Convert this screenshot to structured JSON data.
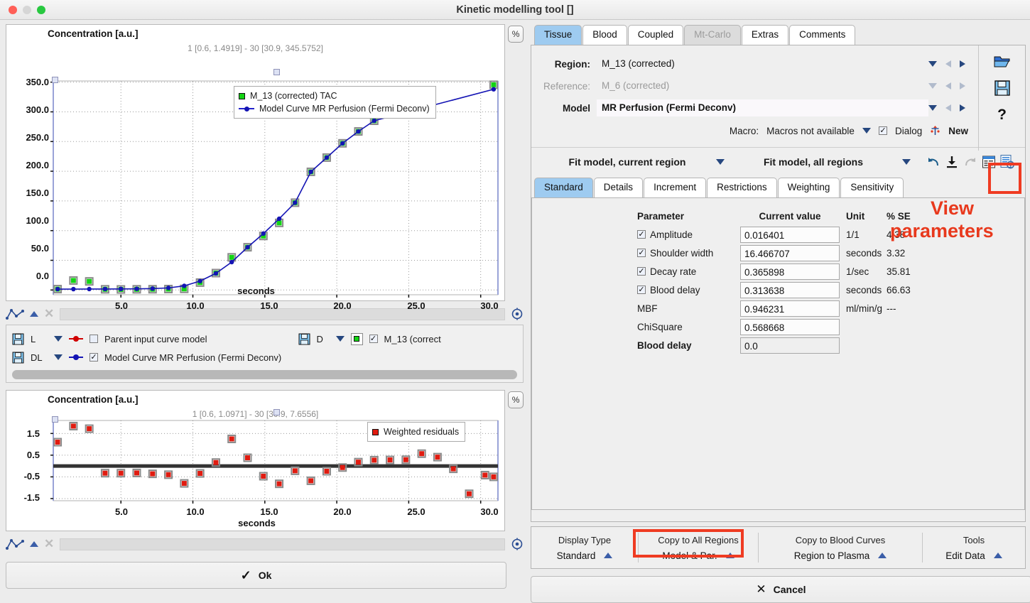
{
  "window": {
    "title": "Kinetic modelling tool []"
  },
  "charts": {
    "main": {
      "title": "Concentration [a.u.]",
      "range_label": "1 [0.6, 1.4919] - 30 [30.9, 345.5752]",
      "xlabel": "seconds",
      "pct_button": "%",
      "legend": [
        {
          "label": "M_13 (corrected) TAC",
          "marker": "square-green"
        },
        {
          "label": "Model Curve MR Perfusion (Fermi Deconv)",
          "marker": "line-blue-dot"
        }
      ]
    },
    "residuals": {
      "title": "Concentration [a.u.]",
      "range_label": "1 [0.6, 1.0971] - 30 [30.9, 7.6556]",
      "xlabel": "seconds",
      "pct_button": "%",
      "legend": [
        {
          "label": "Weighted residuals",
          "marker": "square-red"
        }
      ]
    }
  },
  "chart_data": [
    {
      "type": "scatter",
      "name": "main-tac-plot",
      "title": "Concentration [a.u.]",
      "subtitle": "1 [0.6, 1.4919] - 30 [30.9, 345.5752]",
      "xlabel": "seconds",
      "ylabel": "Concentration [a.u.]",
      "xlim": [
        0.3,
        31.2
      ],
      "ylim": [
        -8,
        352
      ],
      "xticks": [
        5.0,
        10.0,
        15.0,
        20.0,
        25.0,
        30.0
      ],
      "xticklabels": [
        "5.0",
        "10.0",
        "15.0",
        "20.0",
        "25.0",
        "30.0"
      ],
      "yticks": [
        0.0,
        50.0,
        100.0,
        150.0,
        200.0,
        250.0,
        300.0,
        350.0
      ],
      "yticklabels": [
        "0.0",
        "50.0",
        "100.0",
        "150.0",
        "200.0",
        "250.0",
        "300.0",
        "350.0"
      ],
      "grid": true,
      "legend_position": "upper-center",
      "series": [
        {
          "name": "M_13 (corrected) TAC",
          "marker": "square",
          "color": "#14d414",
          "x": [
            0.6,
            1.7,
            2.8,
            3.9,
            5.0,
            6.1,
            7.2,
            8.3,
            9.4,
            10.5,
            11.6,
            12.7,
            13.8,
            14.9,
            16.0,
            17.1,
            18.2,
            19.3,
            20.4,
            21.5,
            22.6,
            30.9
          ],
          "y": [
            1.49,
            16.0,
            14.5,
            1.2,
            1.0,
            1.2,
            1.3,
            1.6,
            1.9,
            12.5,
            28.5,
            55.0,
            72.0,
            91.0,
            113.0,
            147.0,
            199.0,
            223.0,
            247.0,
            267.0,
            285.0,
            345.58
          ]
        },
        {
          "name": "Model Curve MR Perfusion (Fermi Deconv)",
          "marker": "circle-line",
          "color": "#1414b4",
          "x": [
            0.6,
            1.7,
            2.8,
            3.9,
            5.0,
            6.1,
            7.2,
            8.3,
            9.4,
            10.5,
            11.6,
            12.7,
            13.8,
            14.9,
            16.0,
            17.1,
            18.2,
            19.3,
            20.4,
            21.5,
            22.6,
            30.9
          ],
          "y": [
            1.5,
            1.5,
            1.6,
            1.7,
            1.8,
            2.0,
            2.4,
            3.5,
            7.0,
            15.0,
            28.0,
            47.0,
            72.0,
            95.0,
            120.0,
            147.0,
            199.0,
            223.0,
            247.0,
            267.0,
            285.0,
            338.0
          ]
        }
      ]
    },
    {
      "type": "scatter",
      "name": "weighted-residuals-plot",
      "title": "Concentration [a.u.]",
      "subtitle": "1 [0.6, 1.0971] - 30 [30.9, 7.6556]",
      "xlabel": "seconds",
      "ylabel": "Concentration [a.u.]",
      "xlim": [
        0.3,
        31.2
      ],
      "ylim": [
        -1.6,
        2.1
      ],
      "xticks": [
        5.0,
        10.0,
        15.0,
        20.0,
        25.0,
        30.0
      ],
      "xticklabels": [
        "5.0",
        "10.0",
        "15.0",
        "20.0",
        "25.0",
        "30.0"
      ],
      "yticks": [
        -1.5,
        -0.5,
        0.5,
        1.5
      ],
      "yticklabels": [
        "-1.5",
        "-0.5",
        "0.5",
        "1.5"
      ],
      "grid": true,
      "zero_line": true,
      "legend_position": "upper-right",
      "series": [
        {
          "name": "Weighted residuals",
          "marker": "square",
          "color": "#e01b10",
          "x": [
            0.6,
            1.7,
            2.8,
            3.9,
            5.0,
            6.1,
            7.2,
            8.3,
            9.4,
            10.5,
            11.6,
            12.7,
            13.8,
            14.9,
            16.0,
            17.1,
            18.2,
            19.3,
            20.4,
            21.5,
            22.6,
            23.7,
            24.8,
            25.9,
            27.0,
            28.1,
            29.2,
            30.3,
            30.9
          ],
          "y": [
            1.1,
            1.84,
            1.72,
            -0.33,
            -0.33,
            -0.32,
            -0.36,
            -0.4,
            -0.8,
            -0.34,
            0.16,
            1.25,
            0.38,
            -0.47,
            -0.82,
            -0.22,
            -0.68,
            -0.24,
            -0.07,
            0.18,
            0.27,
            0.28,
            0.29,
            0.57,
            0.41,
            -0.13,
            -1.28,
            -0.42,
            -0.5
          ]
        }
      ]
    }
  ],
  "curve_toolbar_top": {
    "bar_placeholder": ""
  },
  "curve_list": {
    "rows": [
      {
        "save_icon": "floppy-icon",
        "mode": "L",
        "marker": "dot-red",
        "checked": false,
        "label": "Parent input curve model"
      },
      {
        "save_icon": "floppy-icon",
        "mode": "DL",
        "marker": "dot-blue",
        "checked": true,
        "label": "Model Curve MR Perfusion (Fermi Deconv)"
      }
    ],
    "right": {
      "save_icon": "floppy-icon",
      "mode": "D",
      "marker": "square-green",
      "checked": true,
      "label": "M_13 (correct"
    }
  },
  "ok_button": {
    "label": "Ok",
    "icon": "check-icon"
  },
  "cancel_button": {
    "label": "Cancel",
    "icon": "close-icon"
  },
  "tabs": {
    "main": [
      {
        "label": "Tissue",
        "state": "active"
      },
      {
        "label": "Blood",
        "state": "normal"
      },
      {
        "label": "Coupled",
        "state": "normal"
      },
      {
        "label": "Mt-Carlo",
        "state": "disabled"
      },
      {
        "label": "Extras",
        "state": "normal"
      },
      {
        "label": "Comments",
        "state": "normal"
      }
    ],
    "sub": [
      {
        "label": "Standard",
        "state": "active"
      },
      {
        "label": "Details",
        "state": "normal"
      },
      {
        "label": "Increment",
        "state": "normal"
      },
      {
        "label": "Restrictions",
        "state": "normal"
      },
      {
        "label": "Weighting",
        "state": "normal"
      },
      {
        "label": "Sensitivity",
        "state": "normal"
      }
    ]
  },
  "tissue": {
    "region_label": "Region:",
    "region_value": "M_13 (corrected)",
    "reference_label": "Reference:",
    "reference_value": "M_6 (corrected)",
    "model_label": "Model",
    "model_value": "MR Perfusion (Fermi Deconv)",
    "macro_label": "Macro:",
    "macro_value": "Macros not available",
    "dialog_label": "Dialog",
    "dialog_checked": true,
    "new_label": "New",
    "side_icons": [
      "open-folder-icon",
      "save-floppy-icon",
      "help-question-icon"
    ]
  },
  "fit_row": {
    "current_region": "Fit model, current region",
    "all_regions": "Fit model, all regions",
    "icons": [
      "undo-icon",
      "download-icon",
      "redo-icon",
      "table-report-icon",
      "view-parameters-icon"
    ]
  },
  "parameters": {
    "headers": {
      "parameter": "Parameter",
      "current_value": "Current value",
      "unit": "Unit",
      "se": "% SE"
    },
    "rows": [
      {
        "checkbox": true,
        "name": "Amplitude",
        "value": "0.016401",
        "unit": "1/1",
        "se": "4.38"
      },
      {
        "checkbox": true,
        "name": "Shoulder width",
        "value": "16.466707",
        "unit": "seconds",
        "se": "3.32"
      },
      {
        "checkbox": true,
        "name": "Decay rate",
        "value": "0.365898",
        "unit": "1/sec",
        "se": "35.81"
      },
      {
        "checkbox": true,
        "name": "Blood delay",
        "value": "0.313638",
        "unit": "seconds",
        "se": "66.63"
      },
      {
        "checkbox": null,
        "name": "MBF",
        "value": "0.946231",
        "unit": "ml/min/g",
        "se": "---"
      },
      {
        "checkbox": null,
        "name": "ChiSquare",
        "value": "0.568668",
        "unit": "",
        "se": ""
      },
      {
        "checkbox": null,
        "name": "Blood delay",
        "value": "0.0",
        "unit": "",
        "se": ""
      }
    ]
  },
  "bottom_bar": {
    "groups": [
      {
        "title": "Display Type",
        "value": "Standard"
      },
      {
        "title": "Copy to All Regions",
        "value": "Model & Par."
      },
      {
        "title": "Copy to Blood Curves",
        "value": "Region to Plasma"
      },
      {
        "title": "Tools",
        "value": "Edit Data"
      }
    ]
  },
  "annotations": [
    {
      "text": "View",
      "color": "#e8391d"
    },
    {
      "text": "parameters",
      "color": "#e8391d"
    }
  ]
}
